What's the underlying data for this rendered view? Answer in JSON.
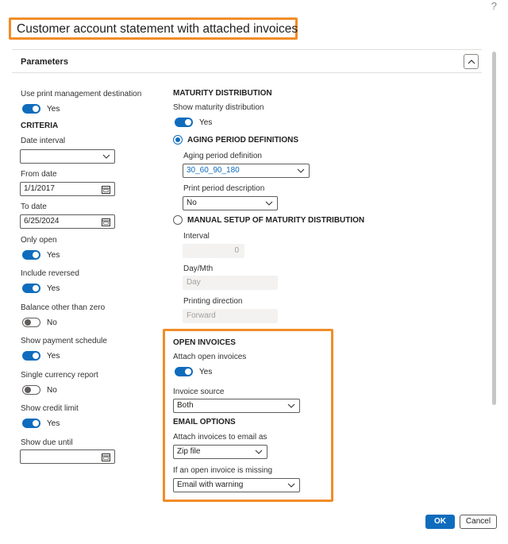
{
  "help_label": "?",
  "dialog_title": "Customer account statement with attached invoices",
  "panel_title": "Parameters",
  "left": {
    "use_print_mgmt_label": "Use print management destination",
    "use_print_mgmt_value": "Yes",
    "criteria_heading": "CRITERIA",
    "date_interval_label": "Date interval",
    "date_interval_value": "",
    "from_date_label": "From date",
    "from_date_value": "1/1/2017",
    "to_date_label": "To date",
    "to_date_value": "6/25/2024",
    "only_open_label": "Only open",
    "only_open_value": "Yes",
    "include_reversed_label": "Include reversed",
    "include_reversed_value": "Yes",
    "balance_other_label": "Balance other than zero",
    "balance_other_value": "No",
    "show_payment_schedule_label": "Show payment schedule",
    "show_payment_schedule_value": "Yes",
    "single_currency_label": "Single currency report",
    "single_currency_value": "No",
    "show_credit_limit_label": "Show credit limit",
    "show_credit_limit_value": "Yes",
    "show_due_until_label": "Show due until",
    "show_due_until_value": ""
  },
  "right": {
    "maturity_heading": "MATURITY DISTRIBUTION",
    "show_maturity_label": "Show maturity distribution",
    "show_maturity_value": "Yes",
    "aging_period_radio_label": "AGING PERIOD DEFINITIONS",
    "aging_def_label": "Aging period definition",
    "aging_def_value": "30_60_90_180",
    "print_period_desc_label": "Print period description",
    "print_period_desc_value": "No",
    "manual_setup_radio_label": "MANUAL SETUP OF MATURITY DISTRIBUTION",
    "interval_label": "Interval",
    "interval_value": "0",
    "day_mth_label": "Day/Mth",
    "day_mth_value": "Day",
    "printing_direction_label": "Printing direction",
    "printing_direction_value": "Forward",
    "open_invoices_heading": "OPEN INVOICES",
    "attach_open_label": "Attach open invoices",
    "attach_open_value": "Yes",
    "invoice_source_label": "Invoice source",
    "invoice_source_value": "Both",
    "email_options_heading": "EMAIL OPTIONS",
    "attach_email_as_label": "Attach invoices to email as",
    "attach_email_as_value": "Zip file",
    "missing_invoice_label": "If an open invoice is missing",
    "missing_invoice_value": "Email with warning"
  },
  "buttons": {
    "ok": "OK",
    "cancel": "Cancel"
  },
  "colors": {
    "accent": "#0f6cbd",
    "highlight": "#f28c28"
  },
  "icons": [
    "help-icon",
    "collapse-chevron-up-icon",
    "chevron-down-icon",
    "calendar-icon"
  ]
}
